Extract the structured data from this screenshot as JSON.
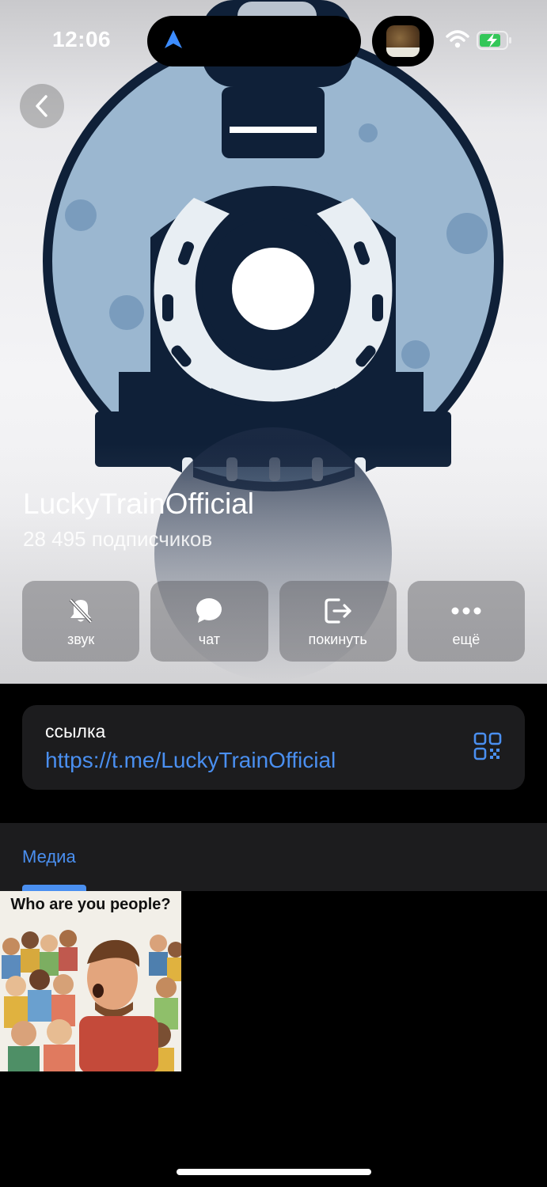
{
  "status_bar": {
    "time": "12:06",
    "location_icon": "navigation-arrow-icon",
    "wifi_icon": "wifi-icon",
    "battery_icon": "battery-charging-icon",
    "battery_color": "#34c759"
  },
  "header": {
    "back_icon": "chevron-left-icon",
    "channel_name": "LuckyTrainOfficial",
    "subscribers": "28 495 подписчиков"
  },
  "actions": [
    {
      "label": "звук",
      "icon": "bell-slash-icon"
    },
    {
      "label": "чат",
      "icon": "chat-bubble-icon"
    },
    {
      "label": "покинуть",
      "icon": "leave-icon"
    },
    {
      "label": "ещё",
      "icon": "more-dots-icon"
    }
  ],
  "link": {
    "title": "ссылка",
    "url": "https://t.me/LuckyTrainOfficial",
    "qr_icon": "qr-code-icon"
  },
  "tabs": [
    {
      "label": "Медиа",
      "selected": true
    }
  ],
  "media": [
    {
      "caption": "Who are you people?"
    }
  ],
  "colors": {
    "accent": "#4a8ff0",
    "background": "#000000",
    "card": "#1c1c1e"
  }
}
